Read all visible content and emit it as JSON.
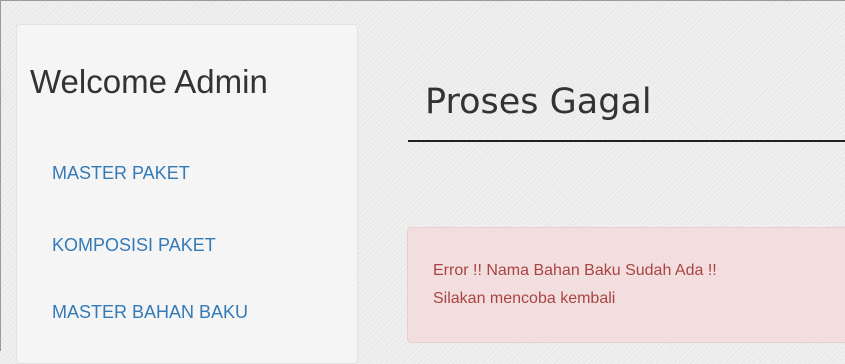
{
  "sidebar": {
    "welcome": "Welcome Admin",
    "items": [
      {
        "label": "MASTER PAKET"
      },
      {
        "label": "KOMPOSISI PAKET"
      },
      {
        "label": "MASTER BAHAN BAKU"
      }
    ]
  },
  "main": {
    "title": "Proses Gagal",
    "alert": {
      "line1": "Error !! Nama Bahan Baku Sudah Ada !!",
      "line2": "Silakan mencoba kembali"
    }
  },
  "colors": {
    "link": "#337ab7",
    "alert_background": "#f2dede",
    "alert_text": "#a94442"
  }
}
